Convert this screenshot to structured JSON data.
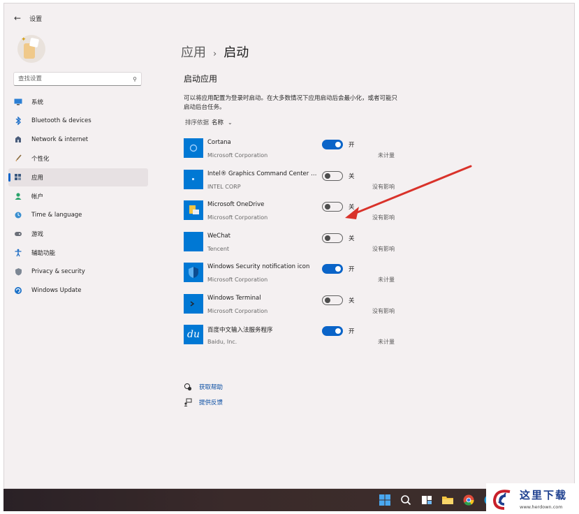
{
  "window": {
    "title": "设置"
  },
  "search": {
    "placeholder": "查找设置"
  },
  "sidebar": {
    "items": [
      {
        "label": "系统",
        "icon": "monitor-icon"
      },
      {
        "label": "Bluetooth & devices",
        "icon": "bluetooth-icon"
      },
      {
        "label": "Network & internet",
        "icon": "network-icon"
      },
      {
        "label": "个性化",
        "icon": "brush-icon"
      },
      {
        "label": "应用",
        "icon": "apps-icon",
        "active": true
      },
      {
        "label": "帐户",
        "icon": "person-icon"
      },
      {
        "label": "Time & language",
        "icon": "globe-clock-icon"
      },
      {
        "label": "游戏",
        "icon": "gamepad-icon"
      },
      {
        "label": "辅助功能",
        "icon": "accessibility-icon"
      },
      {
        "label": "Privacy & security",
        "icon": "shield-icon"
      },
      {
        "label": "Windows Update",
        "icon": "update-icon"
      }
    ]
  },
  "breadcrumb": {
    "parent": "应用",
    "separator": "›",
    "current": "启动"
  },
  "section": {
    "title": "启动应用",
    "description": "可以将应用配置为登录时启动。在大多数情况下应用启动后会最小化，或者可能只启动后台任务。"
  },
  "sort": {
    "label": "排序依据",
    "value": "名称"
  },
  "apps": [
    {
      "name": "Cortana",
      "publisher": "Microsoft Corporation",
      "enabled": true,
      "state": "开",
      "impact": "未计量",
      "icon": "cortana-icon"
    },
    {
      "name": "Intel® Graphics Command Center S...",
      "publisher": "INTEL CORP",
      "enabled": false,
      "state": "关",
      "impact": "没有影响",
      "icon": "intel-graphics-icon"
    },
    {
      "name": "Microsoft OneDrive",
      "publisher": "Microsoft Corporation",
      "enabled": false,
      "state": "关",
      "impact": "没有影响",
      "icon": "onedrive-icon"
    },
    {
      "name": "WeChat",
      "publisher": "Tencent",
      "enabled": false,
      "state": "关",
      "impact": "没有影响",
      "icon": "wechat-icon"
    },
    {
      "name": "Windows Security notification icon",
      "publisher": "Microsoft Corporation",
      "enabled": true,
      "state": "开",
      "impact": "未计量",
      "icon": "windows-security-icon"
    },
    {
      "name": "Windows Terminal",
      "publisher": "Microsoft Corporation",
      "enabled": false,
      "state": "关",
      "impact": "没有影响",
      "icon": "terminal-icon"
    },
    {
      "name": "百度中文输入法服务程序",
      "publisher": "Baidu, Inc.",
      "enabled": true,
      "state": "开",
      "impact": "未计量",
      "icon": "baidu-ime-icon"
    }
  ],
  "links": [
    {
      "label": "获取帮助",
      "icon": "help-icon"
    },
    {
      "label": "提供反馈",
      "icon": "feedback-icon"
    }
  ],
  "taskbar": {
    "icons": [
      "start-icon",
      "search-icon",
      "task-view-icon",
      "file-explorer-icon",
      "chrome-icon",
      "edge-icon"
    ]
  },
  "watermark": {
    "text": "这里下载",
    "url": "www.herdown.com"
  },
  "colors": {
    "accent": "#0a64c8",
    "annotation_arrow": "#d9322a",
    "app_tile": "#0078d4"
  }
}
